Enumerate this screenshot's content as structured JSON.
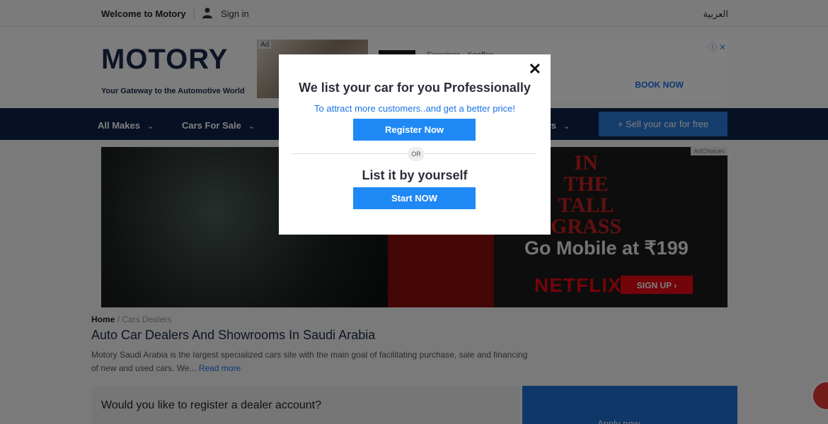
{
  "topbar": {
    "welcome": "Welcome to Motory",
    "signin": "Sign in",
    "language": "العربية"
  },
  "header": {
    "logo": "MOTORY",
    "tagline": "Your Gateway to the Automotive World",
    "ad": {
      "label": "Ad",
      "text": "Exercises - Kooffee",
      "cta": "BOOK NOW"
    }
  },
  "nav": {
    "items": [
      "All Makes",
      "Cars For Sale",
      "News"
    ],
    "sell_button": "+ Sell your car for free"
  },
  "banner": {
    "title_lines": "IN THE TALL GRASS",
    "headline": "Go Mobile at ₹199",
    "brand": "NETFLIX",
    "cta": "SIGN UP",
    "adchoices": "AdChoices"
  },
  "content": {
    "breadcrumb_home": "Home",
    "breadcrumb_current": "Cars Dealers",
    "title": "Auto Car Dealers And Showrooms In Saudi Arabia",
    "description": "Motory Saudi Arabia is the largest specialized cars site with the main goal of facilitating purchase, sale and financing of new and used cars. We...",
    "read_more": "Read more",
    "dealer_question": "Would you like to register a dealer account?",
    "apply_now": "Apply now →"
  },
  "modal": {
    "title": "We list your car for you Professionally",
    "subtitle": "To attract more customers..and get a better price!",
    "register_button": "Register Now",
    "or_label": "OR",
    "title2": "List it by yourself",
    "start_button": "Start NOW",
    "close": "✕"
  },
  "colors": {
    "navy": "#0f2247",
    "accent_blue": "#1e88f5",
    "netflix_red": "#e50914"
  }
}
